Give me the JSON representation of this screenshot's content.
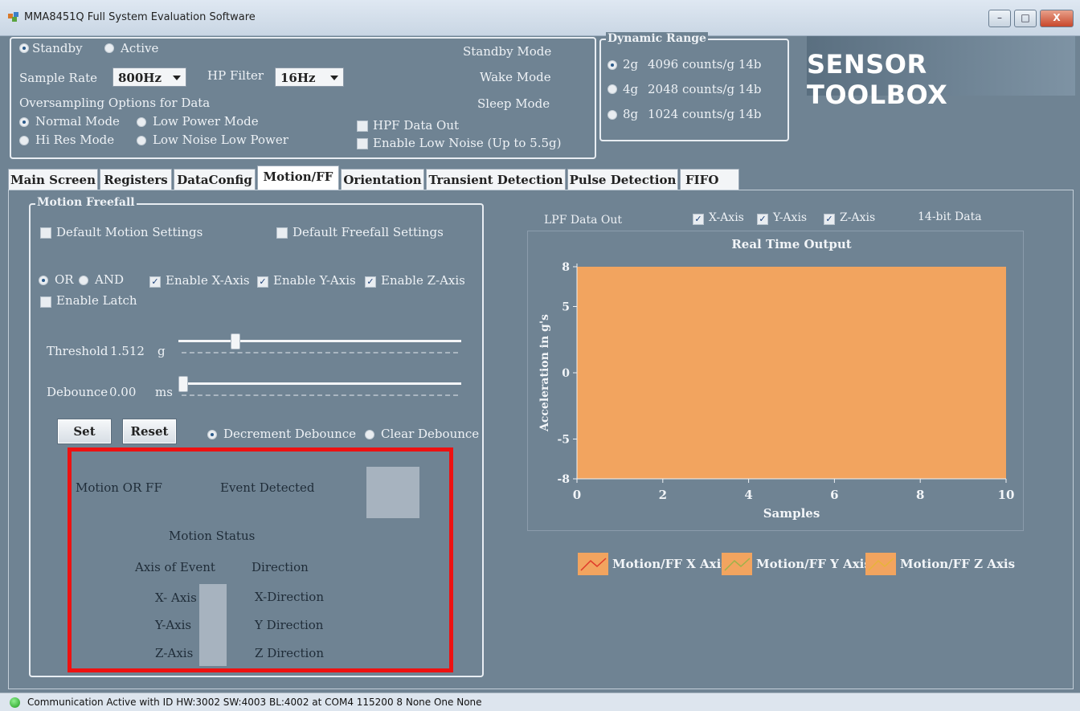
{
  "window": {
    "title": "MMA8451Q Full System Evaluation Software",
    "controls": [
      "–",
      "□",
      "X"
    ]
  },
  "top": {
    "standby": "Standby",
    "active": "Active",
    "sample_rate_label": "Sample Rate",
    "sample_rate_value": "800Hz",
    "hp_filter_label": "HP Filter",
    "hp_filter_value": "16Hz",
    "oversampling_label": "Oversampling Options for Data",
    "normal_mode": "Normal Mode",
    "low_power_mode": "Low Power Mode",
    "hi_res_mode": "Hi Res Mode",
    "low_noise_low_power": "Low Noise Low Power",
    "standby_mode": "Standby Mode",
    "wake_mode": "Wake Mode",
    "sleep_mode": "Sleep Mode",
    "hpf_data_out": "HPF Data Out",
    "enable_low_noise": "Enable Low Noise (Up to 5.5g)"
  },
  "dynamic_range": {
    "title": "Dynamic Range",
    "options": [
      {
        "g": "2g",
        "counts": "4096 counts/g 14b",
        "selected": true
      },
      {
        "g": "4g",
        "counts": "2048 counts/g 14b",
        "selected": false
      },
      {
        "g": "8g",
        "counts": "1024 counts/g 14b",
        "selected": false
      }
    ]
  },
  "logo": "SENSOR TOOLBOX",
  "tabs": [
    "Main Screen",
    "Registers",
    "DataConfig",
    "Motion/FF",
    "Orientation",
    "Transient Detection",
    "Pulse Detection",
    "FIFO"
  ],
  "active_tab": "Motion/FF",
  "motion": {
    "group_title": "Motion Freefall",
    "default_motion": "Default Motion Settings",
    "default_freefall": "Default Freefall Settings",
    "or": "OR",
    "and": "AND",
    "enable_x": "Enable X-Axis",
    "enable_y": "Enable Y-Axis",
    "enable_z": "Enable Z-Axis",
    "enable_latch": "Enable Latch",
    "threshold_label": "Threshold",
    "threshold_value": "1.512",
    "threshold_unit": "g",
    "threshold_level": 0.19,
    "debounce_label": "Debounce",
    "debounce_value": "0.00",
    "debounce_unit": "ms",
    "debounce_level": 0.0,
    "set": "Set",
    "reset": "Reset",
    "decrement_debounce": "Decrement Debounce",
    "clear_debounce": "Clear Debounce"
  },
  "detect": {
    "motion_or_ff": "Motion OR FF",
    "event_detected": "Event Detected",
    "motion_status": "Motion Status",
    "axis_of_event": "Axis of Event",
    "direction": "Direction",
    "x_axis": "X- Axis",
    "y_axis": "Y-Axis",
    "z_axis": "Z-Axis",
    "x_dir": "X-Direction",
    "y_dir": "Y Direction",
    "z_dir": "Z Direction"
  },
  "chart_header": {
    "lpf": "LPF Data Out",
    "x": "X-Axis",
    "y": "Y-Axis",
    "z": "Z-Axis",
    "bits": "14-bit Data"
  },
  "chart_data": {
    "type": "area",
    "title": "Real Time Output",
    "xlabel": "Samples",
    "ylabel": "Acceleration in g's",
    "xlim": [
      0,
      10
    ],
    "ylim": [
      -8,
      8
    ],
    "x_ticks": [
      "0",
      "2",
      "4",
      "6",
      "8",
      "10"
    ],
    "y_ticks": [
      "8",
      "5",
      "0",
      "-5",
      "-8"
    ],
    "fill_color": "#f2a45f",
    "series": [
      {
        "name": "Motion/FF X Axis",
        "color": "#f2a45f"
      },
      {
        "name": "Motion/FF Y Axis",
        "color": "#f2a45f"
      },
      {
        "name": "Motion/FF Z Axis",
        "color": "#f2a45f"
      }
    ]
  },
  "status": "Communication Active with ID HW:3002 SW:4003 BL:4002 at COM4 115200 8 None One None"
}
